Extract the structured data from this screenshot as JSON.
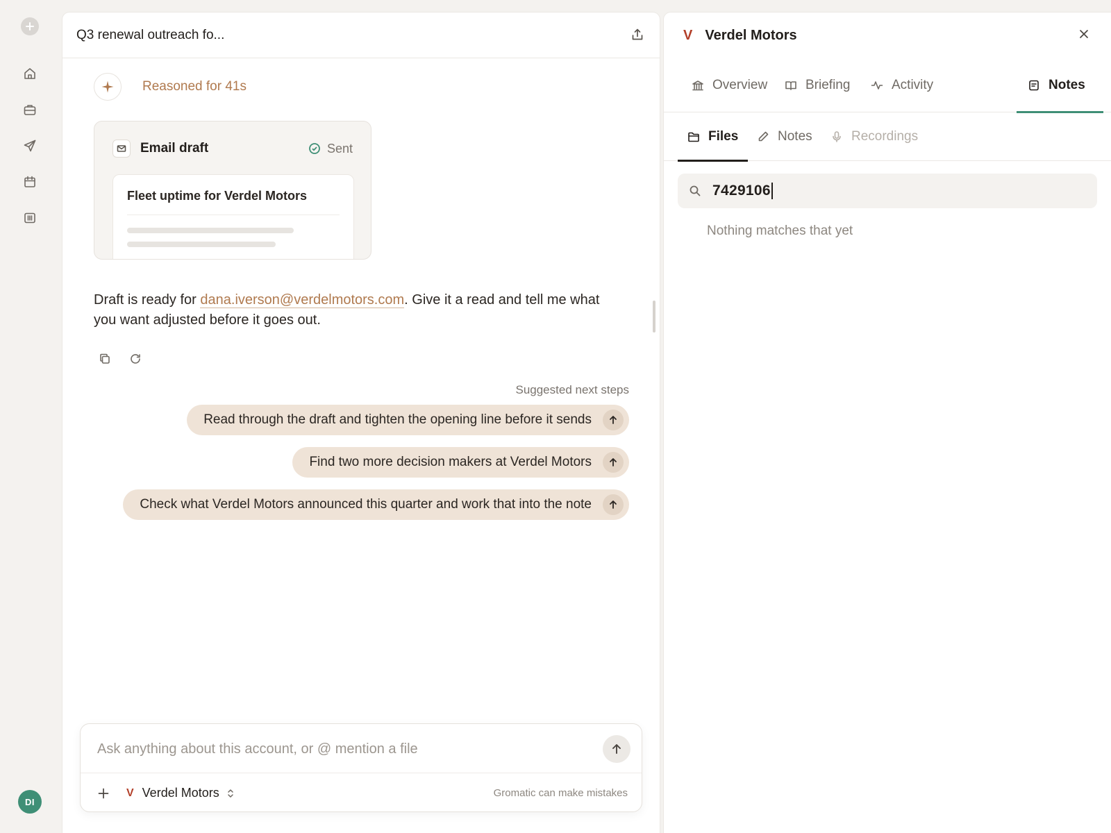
{
  "colors": {
    "accent": "#b07a4f",
    "brand_mark": "#b3402a",
    "active_tab": "#3f8f76",
    "chip_bg": "#efe3d7",
    "avatar_bg": "#3f8f76"
  },
  "rail": {
    "items": [
      "home-icon",
      "briefcase-icon",
      "send-icon",
      "calendar-icon",
      "columns-icon"
    ],
    "avatar_initials": "DI"
  },
  "chat": {
    "title": "Q3 renewal outreach fo...",
    "reasoning": "Reasoned for 41s",
    "email_card": {
      "label": "Email draft",
      "status": "Sent",
      "subject": "Fleet uptime for Verdel Motors"
    },
    "reply": {
      "before": "Draft is ready for ",
      "email": "dana.iverson@verdelmotors.com",
      "after": ". Give it a read and tell me what you want adjusted before it goes out."
    },
    "suggest_label": "Suggested next steps",
    "suggestions": [
      "Read through the draft and tighten the opening line before it sends",
      "Find two more decision makers at Verdel Motors",
      "Check what Verdel Motors announced this quarter and work that into the note"
    ],
    "composer": {
      "placeholder": "Ask anything about this account, or @ mention a file",
      "account": "Verdel Motors",
      "disclaimer": "Gromatic can make mistakes"
    }
  },
  "side": {
    "logo_letter": "V",
    "title": "Verdel Motors",
    "tabs": [
      "Overview",
      "Briefing",
      "Activity",
      "Notes"
    ],
    "active_tab": "Notes",
    "subtabs": [
      "Files",
      "Notes",
      "Recordings"
    ],
    "active_subtab": "Files",
    "search_query": "7429106",
    "empty_message": "Nothing matches that yet"
  }
}
